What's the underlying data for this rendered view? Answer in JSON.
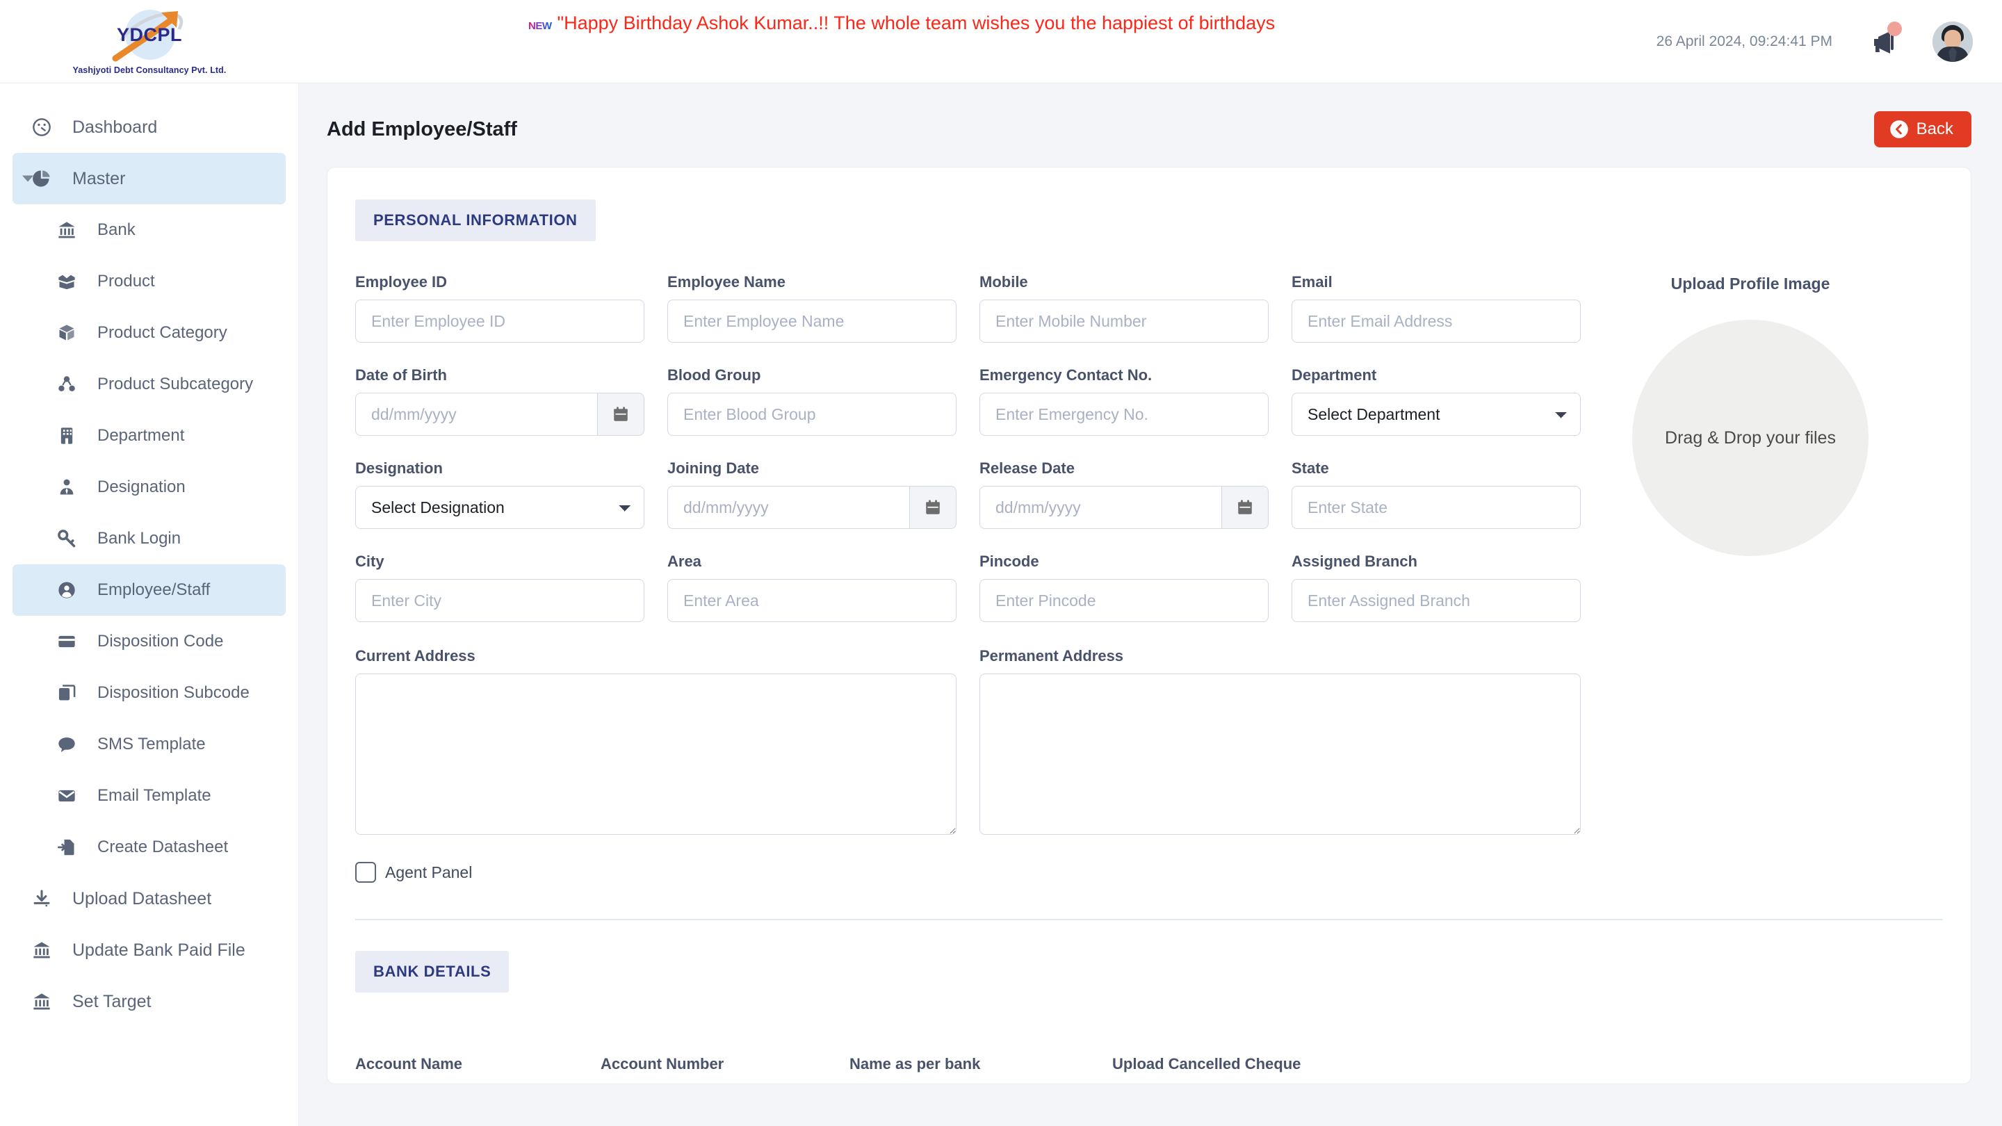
{
  "brand": {
    "logo_text": "YDCPL",
    "company": "Yashjyoti Debt Consultancy Pvt. Ltd."
  },
  "header": {
    "new_badge": "NEW",
    "marquee": "\"Happy Birthday Ashok Kumar..!! The whole team wishes you the happiest of birthdays",
    "datetime": "26 April 2024, 09:24:41 PM",
    "megaphone_icon": "megaphone-icon",
    "avatar_icon": "user-avatar"
  },
  "sidebar": {
    "items": [
      {
        "label": "Dashboard",
        "icon": "dashboard-icon",
        "level": 0,
        "active": false,
        "caret": false
      },
      {
        "label": "Master",
        "icon": "pie-chart-icon",
        "level": 0,
        "active": true,
        "caret": true
      },
      {
        "label": "Bank",
        "icon": "bank-icon",
        "level": 1,
        "active": false,
        "caret": false
      },
      {
        "label": "Product",
        "icon": "open-box-icon",
        "level": 1,
        "active": false,
        "caret": false
      },
      {
        "label": "Product Category",
        "icon": "box-icon",
        "level": 1,
        "active": false,
        "caret": false
      },
      {
        "label": "Product Subcategory",
        "icon": "boxes-icon",
        "level": 1,
        "active": false,
        "caret": false
      },
      {
        "label": "Department",
        "icon": "building-icon",
        "level": 1,
        "active": false,
        "caret": false
      },
      {
        "label": "Designation",
        "icon": "person-tie-icon",
        "level": 1,
        "active": false,
        "caret": false
      },
      {
        "label": "Bank Login",
        "icon": "key-icon",
        "level": 1,
        "active": false,
        "caret": false
      },
      {
        "label": "Employee/Staff",
        "icon": "user-circle-icon",
        "level": 1,
        "active": true,
        "caret": false
      },
      {
        "label": "Disposition Code",
        "icon": "card-icon",
        "level": 1,
        "active": false,
        "caret": false
      },
      {
        "label": "Disposition Subcode",
        "icon": "copy-icon",
        "level": 1,
        "active": false,
        "caret": false
      },
      {
        "label": "SMS Template",
        "icon": "chat-bubble-icon",
        "level": 1,
        "active": false,
        "caret": false
      },
      {
        "label": "Email Template",
        "icon": "envelope-icon",
        "level": 1,
        "active": false,
        "caret": false
      },
      {
        "label": "Create Datasheet",
        "icon": "file-export-icon",
        "level": 1,
        "active": false,
        "caret": false
      },
      {
        "label": "Upload Datasheet",
        "icon": "download-icon",
        "level": 0,
        "active": false,
        "caret": false
      },
      {
        "label": "Update Bank Paid File",
        "icon": "bank-icon",
        "level": 0,
        "active": false,
        "caret": false
      },
      {
        "label": "Set Target",
        "icon": "bank-icon",
        "level": 0,
        "active": false,
        "caret": false
      }
    ]
  },
  "page": {
    "title": "Add Employee/Staff",
    "back_label": "Back",
    "back_icon": "arrow-circle-left-icon"
  },
  "form": {
    "section_personal": "PERSONAL INFORMATION",
    "section_bank": "BANK DETAILS",
    "rows": [
      [
        {
          "label": "Employee ID",
          "placeholder": "Enter Employee ID",
          "type": "text",
          "name": "employee-id"
        },
        {
          "label": "Employee Name",
          "placeholder": "Enter Employee Name",
          "type": "text",
          "name": "employee-name"
        },
        {
          "label": "Mobile",
          "placeholder": "Enter Mobile Number",
          "type": "text",
          "name": "mobile"
        },
        {
          "label": "Email",
          "placeholder": "Enter Email Address",
          "type": "text",
          "name": "email"
        }
      ],
      [
        {
          "label": "Date of Birth",
          "placeholder": "dd/mm/yyyy",
          "type": "date",
          "name": "date-of-birth"
        },
        {
          "label": "Blood Group",
          "placeholder": "Enter Blood Group",
          "type": "text",
          "name": "blood-group"
        },
        {
          "label": "Emergency Contact No.",
          "placeholder": "Enter Emergency No.",
          "type": "text",
          "name": "emergency-contact"
        },
        {
          "label": "Department",
          "value": "Select Department",
          "type": "select",
          "name": "department"
        }
      ],
      [
        {
          "label": "Designation",
          "value": "Select Designation",
          "type": "select",
          "name": "designation"
        },
        {
          "label": "Joining Date",
          "placeholder": "dd/mm/yyyy",
          "type": "date",
          "name": "joining-date"
        },
        {
          "label": "Release Date",
          "placeholder": "dd/mm/yyyy",
          "type": "date",
          "name": "release-date"
        },
        {
          "label": "State",
          "placeholder": "Enter State",
          "type": "text",
          "name": "state"
        }
      ],
      [
        {
          "label": "City",
          "placeholder": "Enter City",
          "type": "text",
          "name": "city"
        },
        {
          "label": "Area",
          "placeholder": "Enter Area",
          "type": "text",
          "name": "area"
        },
        {
          "label": "Pincode",
          "placeholder": "Enter Pincode",
          "type": "text",
          "name": "pincode"
        },
        {
          "label": "Assigned Branch",
          "placeholder": "Enter Assigned Branch",
          "type": "text",
          "name": "assigned-branch"
        }
      ]
    ],
    "address": [
      {
        "label": "Current Address",
        "placeholder": "",
        "name": "current-address"
      },
      {
        "label": "Permanent Address",
        "placeholder": "",
        "name": "permanent-address"
      }
    ],
    "agent_panel_label": "Agent Panel",
    "bank_labels": [
      "Account Name",
      "Account Number",
      "Name as per bank",
      "Upload Cancelled Cheque"
    ]
  },
  "upload": {
    "title": "Upload Profile Image",
    "dropzone_text": "Drag & Drop your files"
  },
  "colors": {
    "accent_red": "#e13b24",
    "sidebar_active": "#dcebf8",
    "marquee_red": "#fd2718",
    "brand_navy": "#2a2a8c"
  }
}
